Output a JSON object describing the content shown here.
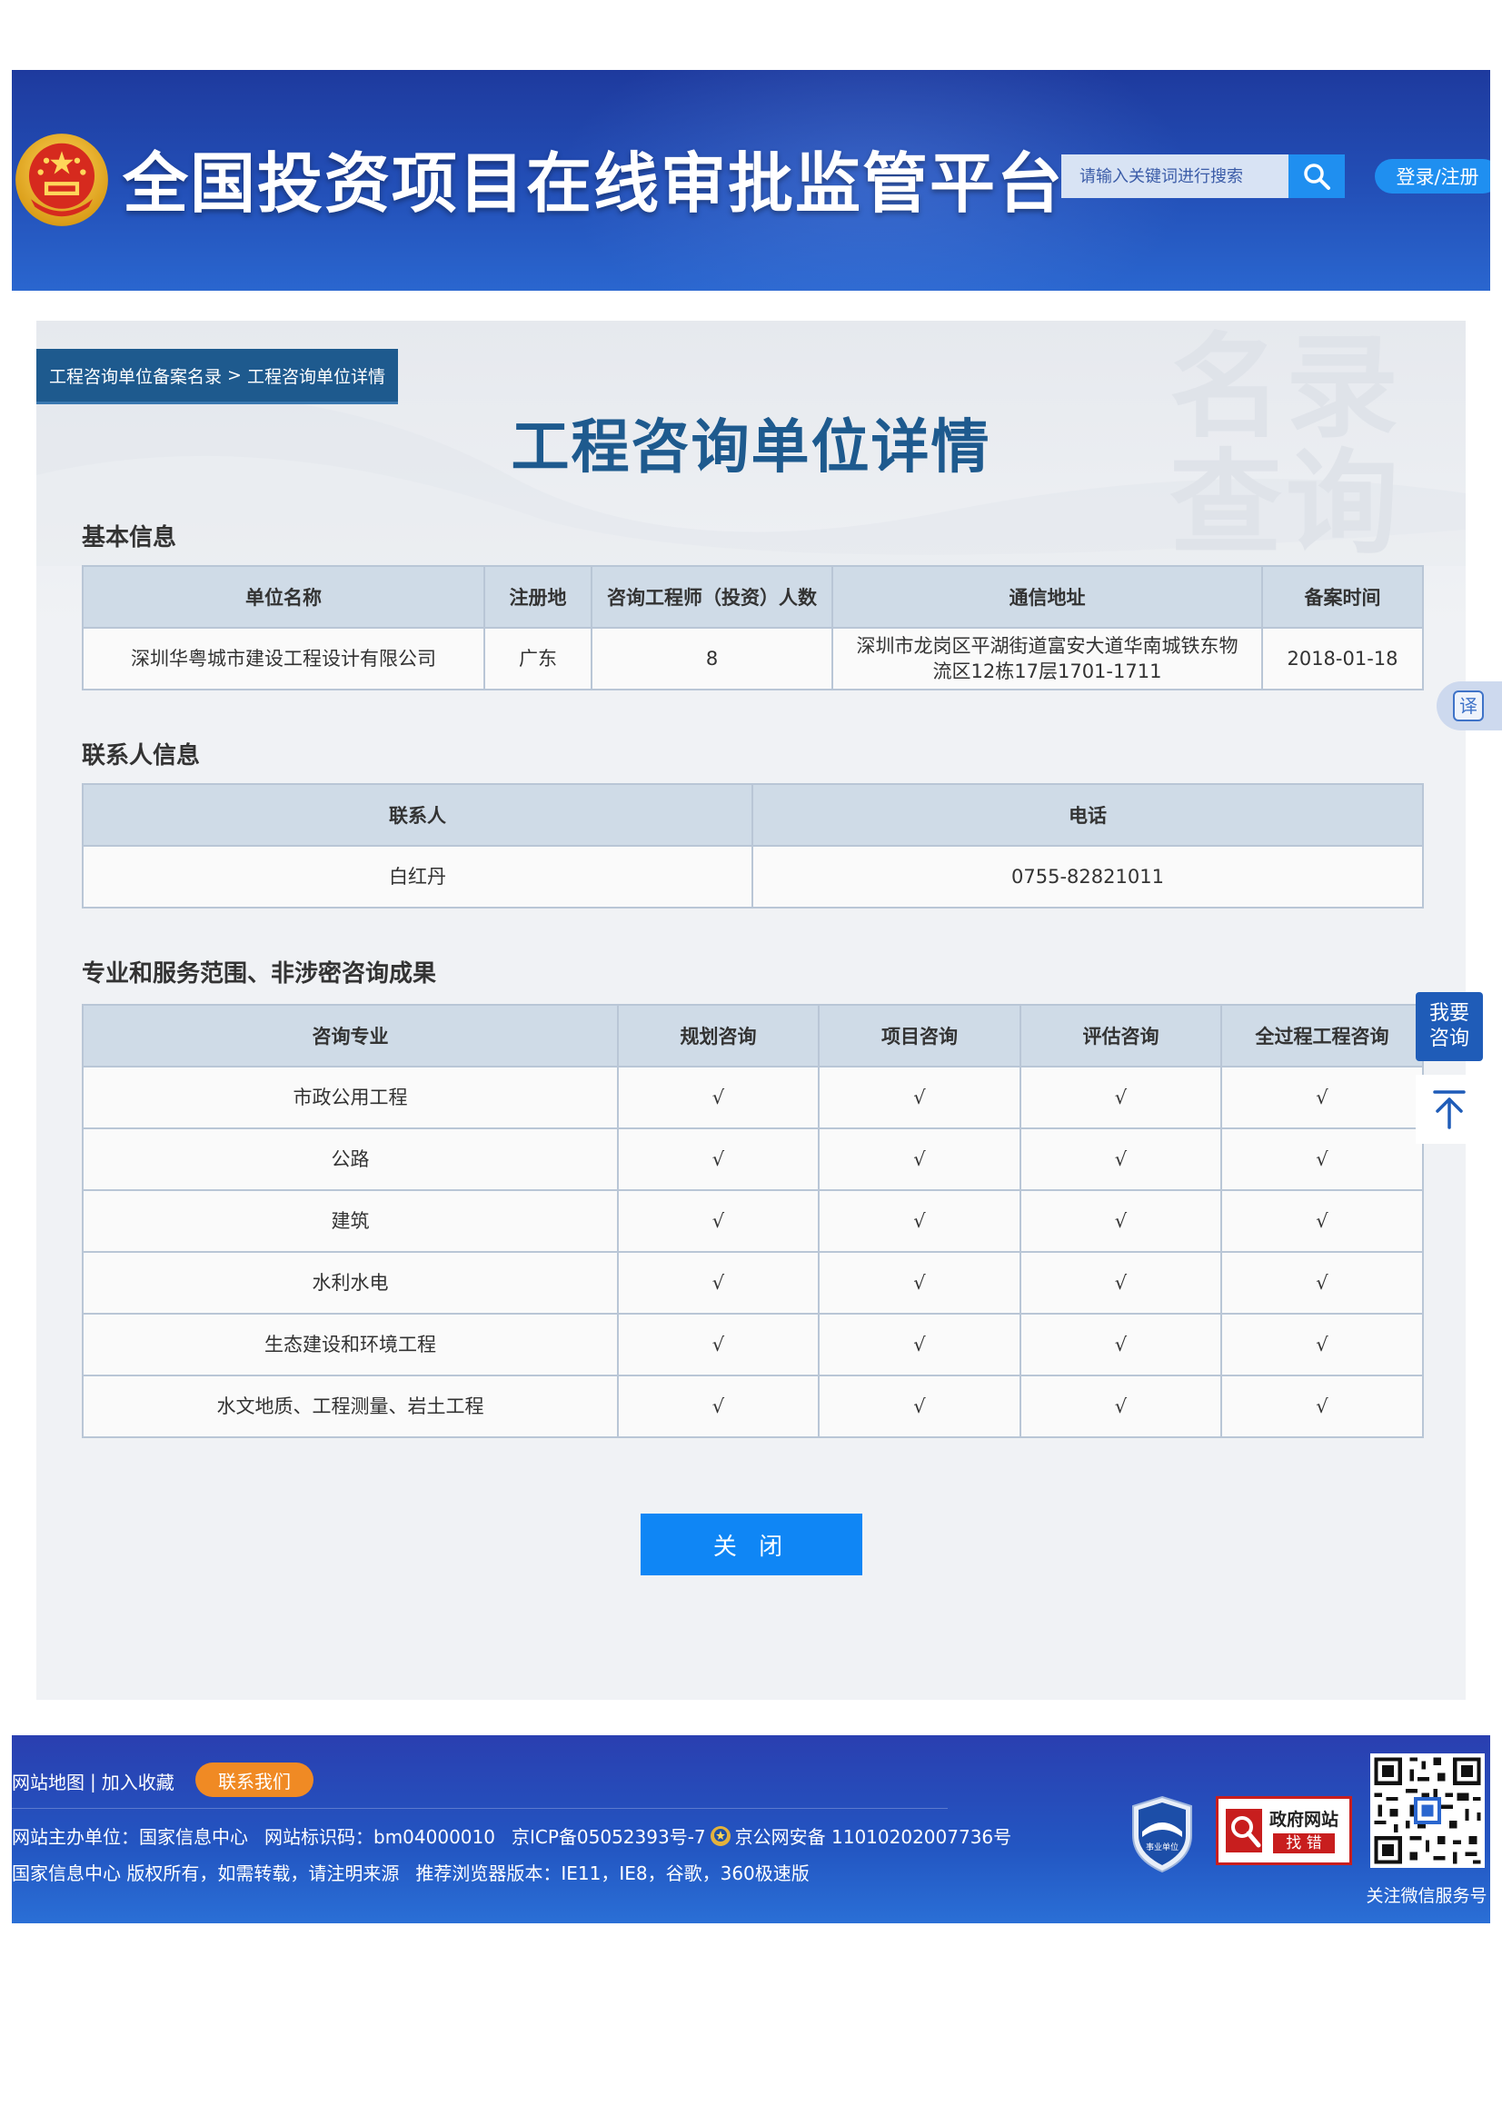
{
  "header": {
    "site_title": "全国投资项目在线审批监管平台",
    "search_placeholder": "请输入关键词进行搜索",
    "login_label": "登录/注册"
  },
  "breadcrumb": {
    "parent": "工程咨询单位备案名录",
    "separator": ">",
    "current": "工程咨询单位详情"
  },
  "watermark": {
    "line1": "名录",
    "line2": "查询"
  },
  "page_title": "工程咨询单位详情",
  "basic_info": {
    "section_title": "基本信息",
    "columns": [
      "单位名称",
      "注册地",
      "咨询工程师（投资）人数",
      "通信地址",
      "备案时间"
    ],
    "row": {
      "name": "深圳华粤城市建设工程设计有限公司",
      "region": "广东",
      "engineers": "8",
      "address": "深圳市龙岗区平湖街道富安大道华南城铁东物流区12栋17层1701-1711",
      "date": "2018-01-18"
    }
  },
  "contact_info": {
    "section_title": "联系人信息",
    "columns": [
      "联系人",
      "电话"
    ],
    "row": {
      "person": "白红丹",
      "phone": "0755-82821011"
    }
  },
  "scope": {
    "section_title": "专业和服务范围、非涉密咨询成果",
    "columns": [
      "咨询专业",
      "规划咨询",
      "项目咨询",
      "评估咨询",
      "全过程工程咨询"
    ],
    "rows": [
      {
        "major": "市政公用工程",
        "c1": "√",
        "c2": "√",
        "c3": "√",
        "c4": "√"
      },
      {
        "major": "公路",
        "c1": "√",
        "c2": "√",
        "c3": "√",
        "c4": "√"
      },
      {
        "major": "建筑",
        "c1": "√",
        "c2": "√",
        "c3": "√",
        "c4": "√"
      },
      {
        "major": "水利水电",
        "c1": "√",
        "c2": "√",
        "c3": "√",
        "c4": "√"
      },
      {
        "major": "生态建设和环境工程",
        "c1": "√",
        "c2": "√",
        "c3": "√",
        "c4": "√"
      },
      {
        "major": "水文地质、工程测量、岩土工程",
        "c1": "√",
        "c2": "√",
        "c3": "√",
        "c4": "√"
      }
    ]
  },
  "close_label": "关 闭",
  "side": {
    "translate_label": "译",
    "consult_label": "我要咨询"
  },
  "footer": {
    "sitemap": "网站地图",
    "divider": "|",
    "favorite": "加入收藏",
    "contact_us": "联系我们",
    "sponsor": "网站主办单位：国家信息中心",
    "site_id": "网站标识码：bm04000010",
    "icp": "京ICP备05052393号-7",
    "police": "京公网安备 11010202007736号",
    "copyright": "国家信息中心 版权所有，如需转载，请注明来源",
    "browsers": "推荐浏览器版本：IE11，IE8，谷歌，360极速版",
    "shield_label": "事业单位",
    "gov_badge_line1": "政府网站",
    "gov_badge_line2": "找 错",
    "qr_caption": "关注微信服务号"
  },
  "colors": {
    "header_blue": "#2350b8",
    "accent_blue": "#0f86f5",
    "title_blue": "#1e5a8e",
    "orange": "#f08a24",
    "table_header": "#cfdbe7"
  },
  "icons": {
    "emblem": "national-emblem-icon",
    "search": "search-icon",
    "translate": "translate-icon",
    "to_top": "arrow-up-to-top-icon",
    "shield": "shield-badge-icon",
    "gov_badge": "gov-site-error-badge-icon",
    "qr": "qr-code-icon",
    "police": "police-emblem-icon"
  }
}
